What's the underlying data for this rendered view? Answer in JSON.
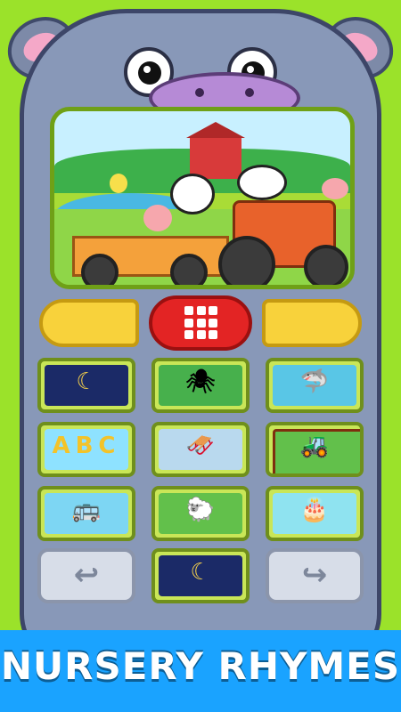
{
  "banner": {
    "title": "NURSERY RHYMES"
  },
  "screen": {
    "scene": "farm-tractor"
  },
  "controls": {
    "left_nav": "left-yellow-button",
    "right_nav": "right-yellow-button",
    "dialpad": "dialpad-button"
  },
  "tiles": [
    {
      "id": "twinkle",
      "art": "night",
      "glyph": "moon-icon"
    },
    {
      "id": "spider",
      "art": "spider",
      "glyph": "spider-icon"
    },
    {
      "id": "shark",
      "art": "shark",
      "glyph": "shark-icon"
    },
    {
      "id": "abc",
      "art": "abc",
      "glyph": "ABC"
    },
    {
      "id": "winter",
      "art": "winter",
      "glyph": "sleigh-icon"
    },
    {
      "id": "farm",
      "art": "tractor",
      "glyph": "tractor-icon"
    },
    {
      "id": "bus",
      "art": "bus",
      "glyph": "bus-icon"
    },
    {
      "id": "sheep",
      "art": "sheep",
      "glyph": "sheep-icon"
    },
    {
      "id": "cake",
      "art": "cake",
      "glyph": "cake-icon"
    },
    {
      "id": "lullaby",
      "art": "lullaby",
      "glyph": "sleeping-baby-icon"
    }
  ],
  "arrows": {
    "back": "left-arrow-icon",
    "forward": "right-arrow-icon"
  },
  "colors": {
    "background": "#9be22a",
    "phone": "#8898b8",
    "banner": "#1aa3ff",
    "dialpad": "#e32424",
    "nav": "#f8d23b"
  }
}
